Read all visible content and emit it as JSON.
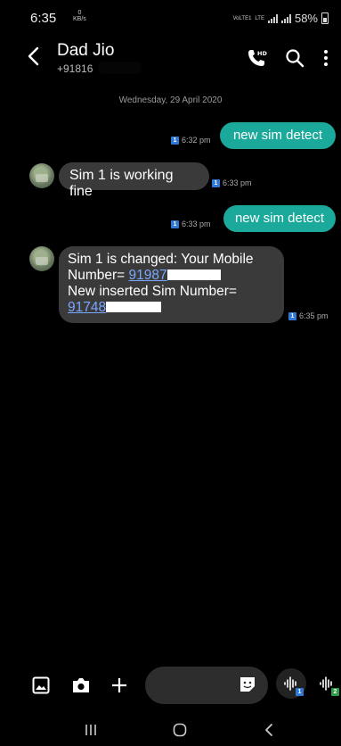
{
  "status": {
    "time": "6:35",
    "speed_value": "0",
    "speed_unit": "KB/s",
    "net1": "VoLTE1",
    "net2": "LTE",
    "battery": "58%"
  },
  "header": {
    "contact_name": "Dad Jio",
    "contact_number": "+91816"
  },
  "date_separator": "Wednesday, 29 April 2020",
  "messages": [
    {
      "direction": "out",
      "text": "new sim detect",
      "time": "6:32 pm",
      "sim": "1"
    },
    {
      "direction": "in",
      "text": "Sim 1 is working fine",
      "time": "6:33 pm",
      "sim": "1"
    },
    {
      "direction": "out",
      "text": "new sim detect",
      "time": "6:33 pm",
      "sim": "1"
    },
    {
      "direction": "in",
      "line1": "Sim 1 is changed: Your Mobile",
      "line2_prefix": "Number= ",
      "link1": "91987",
      "line3": "New inserted Sim Number=",
      "link2": "91748",
      "time": "6:35 pm",
      "sim": "1"
    }
  ],
  "composer": {
    "voice_sim1": "1",
    "voice_sim2": "2"
  },
  "colors": {
    "outgoing_bubble": "#1aa99a",
    "incoming_bubble": "#3a3a3a",
    "sim_badge": "#2f78d6",
    "sim2_badge": "#2e9b4a",
    "link": "#7aa7ff"
  },
  "icons": [
    "back-arrow-icon",
    "hd-call-icon",
    "search-icon",
    "more-vert-icon",
    "gallery-icon",
    "camera-icon",
    "plus-icon",
    "sticker-icon",
    "voice-icon",
    "recents-icon",
    "home-icon",
    "nav-back-icon"
  ]
}
